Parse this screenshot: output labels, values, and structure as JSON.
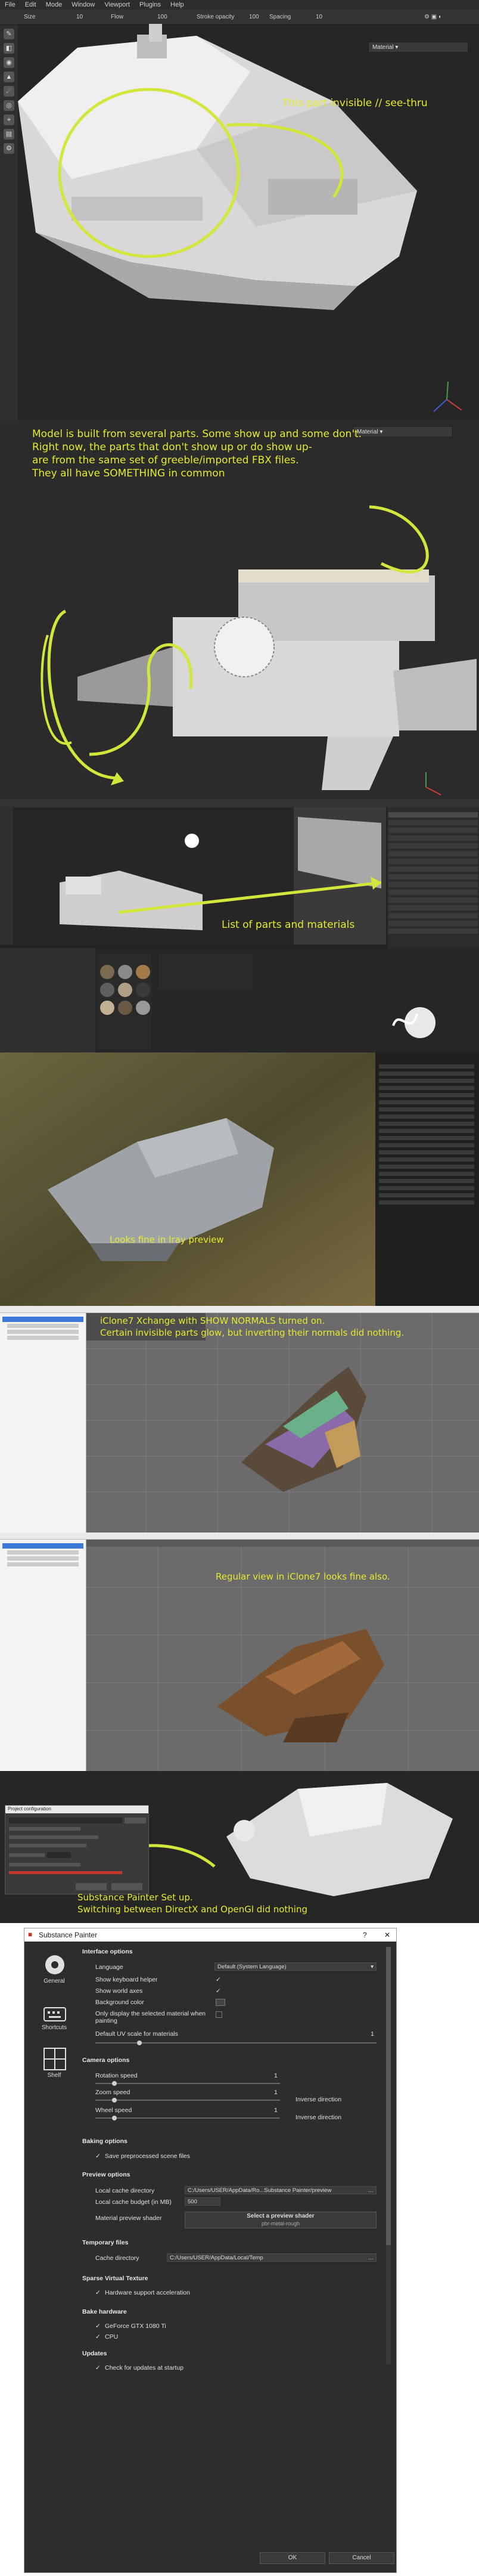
{
  "panel1": {
    "menu": [
      "File",
      "Edit",
      "Mode",
      "Window",
      "Viewport",
      "Plugins",
      "Help"
    ],
    "toolbar": {
      "size_label": "Size",
      "size_value": "10",
      "flow_label": "Flow",
      "flow_value": "100",
      "stroke_label": "Stroke opacity",
      "stroke_value": "100",
      "spacing_label": "Spacing",
      "spacing_value": "10",
      "material_select": "Material"
    },
    "annotation": "This part invisible // see-thru"
  },
  "panel2": {
    "annotation": "Model is built from several parts. Some show up and some don't.\nRight now, the parts that don't show up or do show up-\nare from the same set of greeble/imported FBX files.\nThey all have SOMETHING in common",
    "material_select": "Material"
  },
  "panel3": {
    "annotation": "List of parts and materials"
  },
  "panel4": {
    "annotation": "Looks fine in Iray preview"
  },
  "panel5": {
    "annotation": "iClone7 Xchange with SHOW NORMALS turned on.\nCertain invisible parts glow, but inverting their normals did nothing."
  },
  "panel6": {
    "annotation": "Regular view in iClone7 looks fine also."
  },
  "panel7": {
    "dialog_title": "Project configuration",
    "annotation": "Substance Painter Set up.\nSwitching between DirectX and OpenGl did nothing"
  },
  "substance": {
    "title": "Substance Painter",
    "help": "?",
    "close": "✕",
    "sidebar": [
      {
        "label": "General",
        "icon": "gear-icon"
      },
      {
        "label": "Shortcuts",
        "icon": "keyboard-icon"
      },
      {
        "label": "Shelf",
        "icon": "grid-icon"
      }
    ],
    "interface": {
      "title": "Interface options",
      "language_label": "Language",
      "language_value": "Default (System Language)",
      "show_keyboard": "Show keyboard helper",
      "show_world": "Show world axes",
      "bg_color": "Background color",
      "only_display": "Only display the selected material when painting",
      "uv_scale": "Default UV scale for materials",
      "uv_value": "1"
    },
    "camera": {
      "title": "Camera options",
      "rotation": "Rotation speed",
      "rotation_value": "1",
      "zoom": "Zoom speed",
      "zoom_value": "1",
      "wheel": "Wheel speed",
      "wheel_value": "1",
      "inverse": "Inverse direction"
    },
    "baking": {
      "title": "Baking options",
      "save": "Save preprocessed scene files"
    },
    "preview": {
      "title": "Preview options",
      "cache_dir": "Local cache directory",
      "cache_path": "C:/Users/USER/AppData/Ro...Substance Painter/preview",
      "cache_budget": "Local cache budget (in MB)",
      "budget_value": "500",
      "shader_label": "Material preview shader",
      "shader_btn": "Select a preview shader",
      "shader_sub": "pbr-metal-rough"
    },
    "temp": {
      "title": "Temporary files",
      "cache_dir": "Cache directory",
      "path": "C:/Users/USER/AppData/Local/Temp"
    },
    "svt": {
      "title": "Sparse Virtual Texture",
      "hw": "Hardware support acceleration"
    },
    "bake_hw": {
      "title": "Bake hardware",
      "gpu": "GeForce GTX 1080 Ti",
      "cpu": "CPU"
    },
    "updates": {
      "title": "Updates",
      "check": "Check for updates at startup"
    },
    "ok": "OK",
    "cancel": "Cancel",
    "check": "✓"
  }
}
